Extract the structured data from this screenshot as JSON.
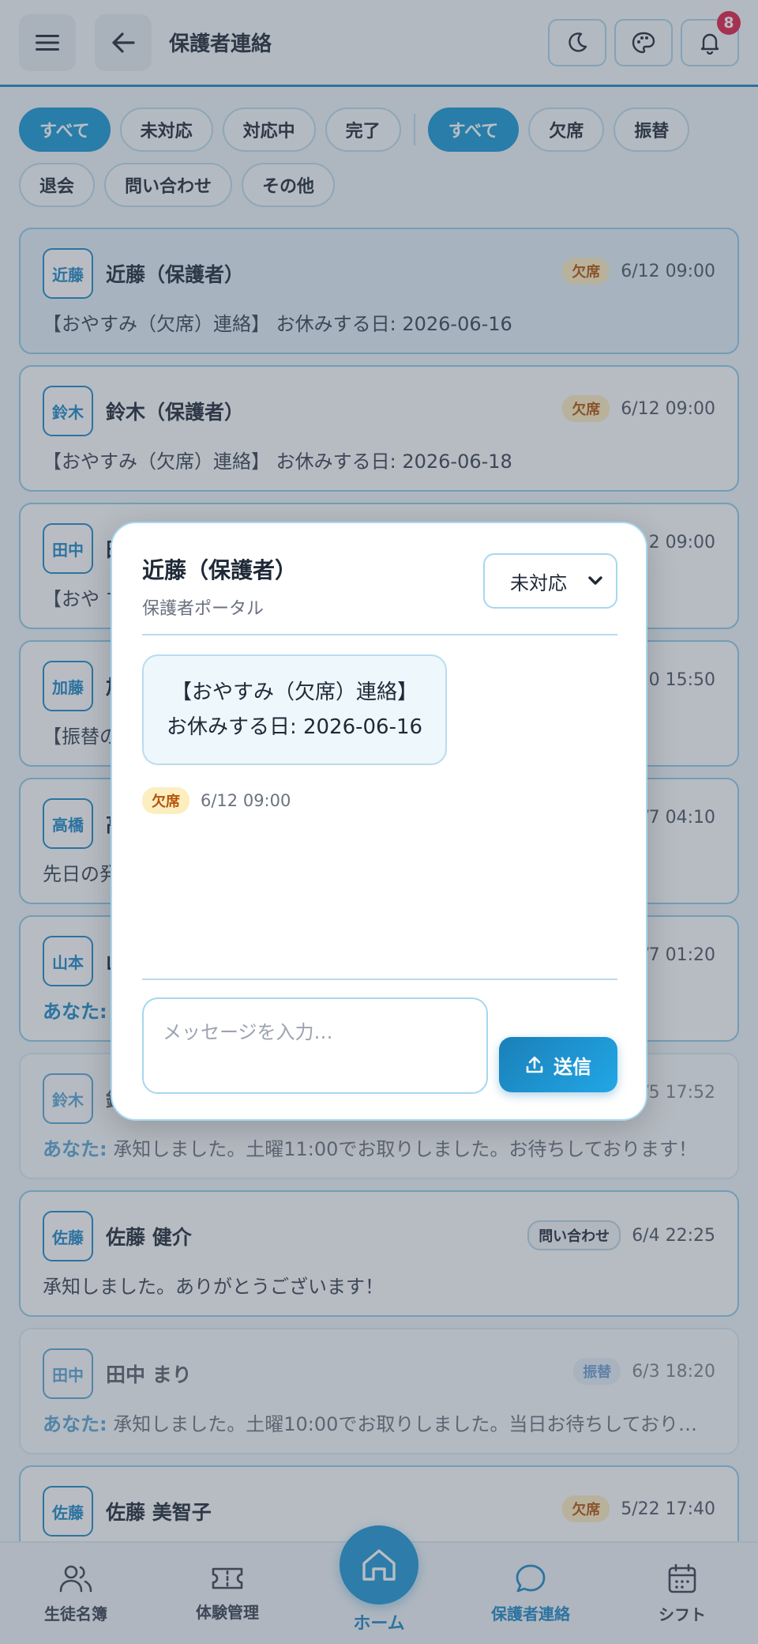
{
  "header": {
    "title": "保護者連絡",
    "notification_count": "8"
  },
  "filters": {
    "status": [
      "すべて",
      "未対応",
      "対応中",
      "完了"
    ],
    "category": [
      "すべて",
      "欠席",
      "振替",
      "退会",
      "問い合わせ",
      "その他"
    ]
  },
  "messages": [
    {
      "avatar": "近藤",
      "name": "近藤（保護者）",
      "tag": "欠席",
      "time": "6/12 09:00",
      "you_prefix": "",
      "body": "【おやすみ（欠席）連絡】 お休みする日: 2026-06-16"
    },
    {
      "avatar": "鈴木",
      "name": "鈴木（保護者）",
      "tag": "欠席",
      "time": "6/12 09:00",
      "you_prefix": "",
      "body": "【おやすみ（欠席）連絡】 お休みする日: 2026-06-18"
    },
    {
      "avatar": "田中",
      "name": "田",
      "tag": "",
      "time": "2 09:00",
      "you_prefix": "",
      "body": "【おや す"
    },
    {
      "avatar": "加藤",
      "name": "加",
      "tag": "",
      "time": "0 15:50",
      "you_prefix": "",
      "body": "【振替の"
    },
    {
      "avatar": "高橋",
      "name": "高",
      "tag": "",
      "time": "/7 04:10",
      "you_prefix": "",
      "body": "先日の発"
    },
    {
      "avatar": "山本",
      "name": "山",
      "tag": "",
      "time": "/7 01:20",
      "you_prefix": "あなた:",
      "body": ""
    },
    {
      "avatar": "鈴木",
      "name": "鈴",
      "tag": "",
      "time": "/5 17:52",
      "you_prefix": "あなた:",
      "body": "承知しました。土曜11:00でお取りしました。お待ちしております！"
    },
    {
      "avatar": "佐藤",
      "name": "佐藤 健介",
      "tag": "問い合わせ",
      "time": "6/4 22:25",
      "you_prefix": "",
      "body": "承知しました。ありがとうございます！"
    },
    {
      "avatar": "田中",
      "name": "田中 まり",
      "tag": "振替",
      "time": "6/3 18:20",
      "you_prefix": "あなた:",
      "body": "承知しました。土曜10:00でお取りしました。当日お待ちしておりま…"
    },
    {
      "avatar": "佐藤",
      "name": "佐藤 美智子",
      "tag": "欠席",
      "time": "5/22 17:40",
      "you_prefix": "",
      "body": ""
    }
  ],
  "modal": {
    "name": "近藤（保護者）",
    "source": "保護者ポータル",
    "status_value": "未対応",
    "bubble_line1": "【おやすみ（欠席）連絡】",
    "bubble_line2": "お休みする日: 2026-06-16",
    "tag": "欠席",
    "time": "6/12 09:00",
    "input_placeholder": "メッセージを入力…",
    "send_label": "送信"
  },
  "nav": {
    "students": "生徒名簿",
    "trial": "体験管理",
    "home": "ホーム",
    "contact": "保護者連絡",
    "shift": "シフト"
  }
}
